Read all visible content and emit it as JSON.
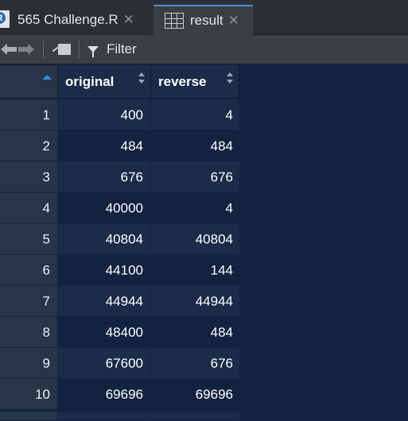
{
  "tabs": [
    {
      "label": "565 Challenge.R",
      "icon": "r-script-icon",
      "active": false
    },
    {
      "label": "result",
      "icon": "data-grid-icon",
      "active": true
    }
  ],
  "toolbar": {
    "filter_label": "Filter"
  },
  "table": {
    "columns": [
      "original",
      "reverse"
    ],
    "sorted_column": "index",
    "rows": [
      {
        "index": "1",
        "original": "400",
        "reverse": "4"
      },
      {
        "index": "2",
        "original": "484",
        "reverse": "484"
      },
      {
        "index": "3",
        "original": "676",
        "reverse": "676"
      },
      {
        "index": "4",
        "original": "40000",
        "reverse": "4"
      },
      {
        "index": "5",
        "original": "40804",
        "reverse": "40804"
      },
      {
        "index": "6",
        "original": "44100",
        "reverse": "144"
      },
      {
        "index": "7",
        "original": "44944",
        "reverse": "44944"
      },
      {
        "index": "8",
        "original": "48400",
        "reverse": "484"
      },
      {
        "index": "9",
        "original": "67600",
        "reverse": "676"
      },
      {
        "index": "10",
        "original": "69696",
        "reverse": "69696"
      }
    ]
  },
  "colors": {
    "background": "#132441",
    "accent": "#3f86d8",
    "row_odd": "#1b2b48",
    "row_even": "#122240"
  }
}
